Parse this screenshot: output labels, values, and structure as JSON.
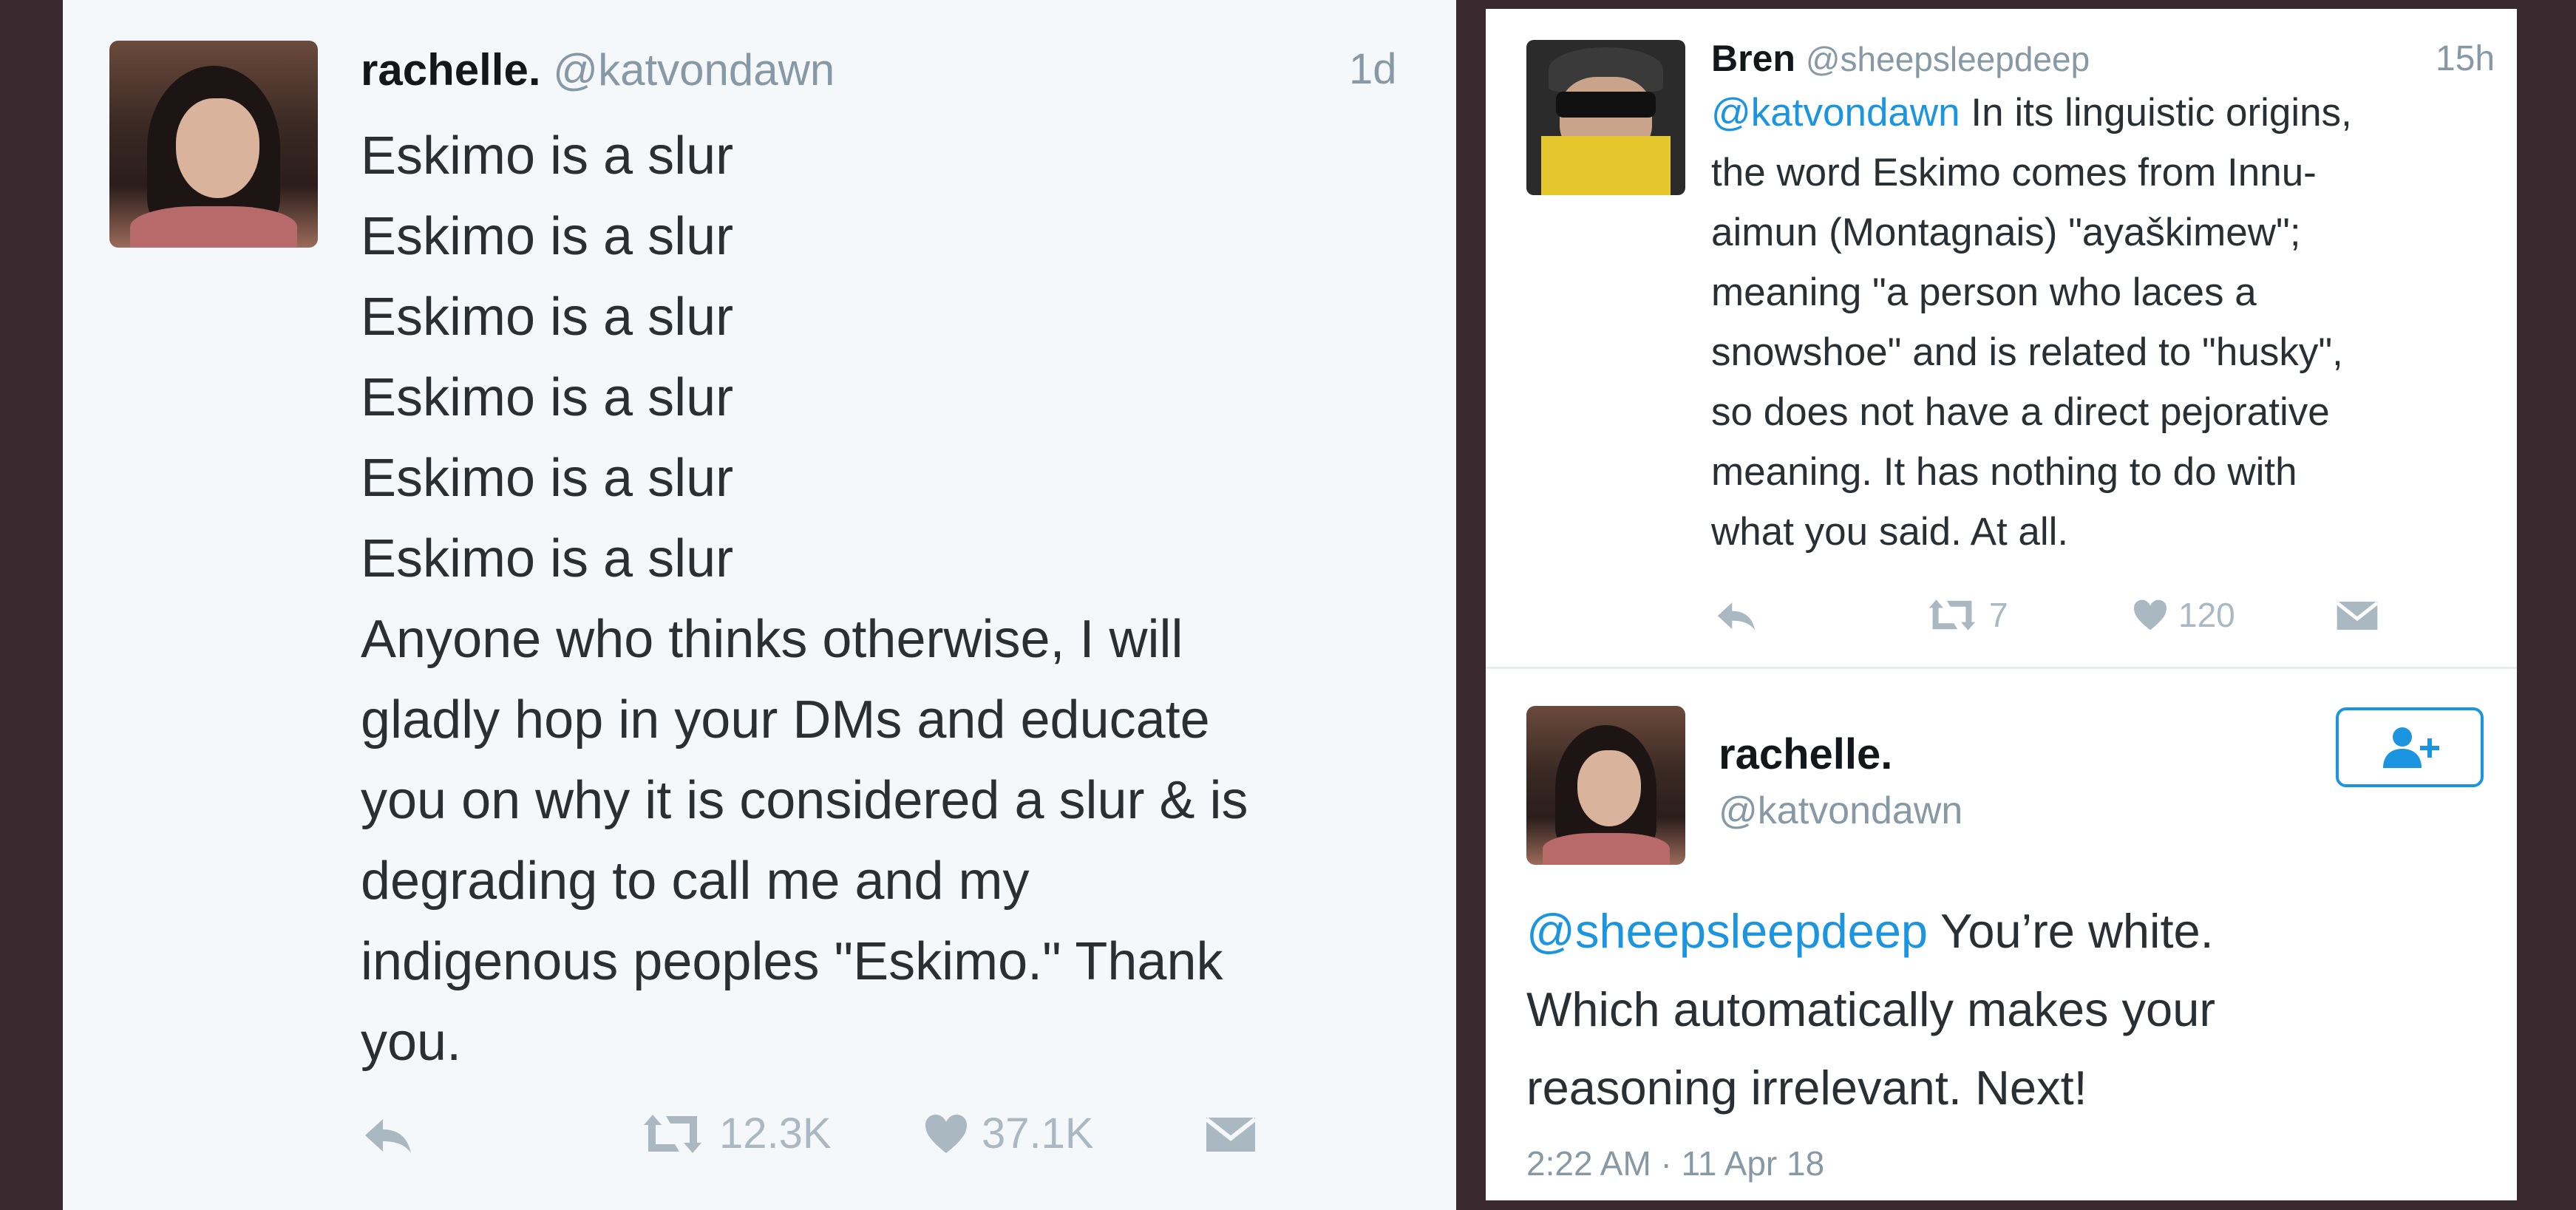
{
  "left_tweet": {
    "name": "rachelle.",
    "handle": "@katvondawn",
    "time": "1d",
    "lines": [
      "Eskimo is a slur",
      "Eskimo is a slur",
      "Eskimo is a slur",
      "Eskimo is a slur",
      "Eskimo is a slur",
      "Eskimo is a slur",
      "Anyone who thinks otherwise, I will",
      "gladly hop in your DMs and educate",
      "you on why it is considered a slur & is",
      "degrading to call me and my",
      "indigenous peoples \"Eskimo.\" Thank",
      "you."
    ],
    "retweets": "12.3K",
    "likes": "37.1K",
    "icons": [
      "reply-icon",
      "retweet-icon",
      "heart-icon",
      "dm-icon"
    ]
  },
  "right_reply": {
    "name": "Bren",
    "handle": "@sheepsleepdeep",
    "time": "15h",
    "mention": "@katvondawn",
    "first_line_rest": " In its linguistic origins,",
    "lines": [
      "the word Eskimo comes from Innu-",
      "aimun (Montagnais) \"ayaškimew\";",
      "meaning \"a person who laces a",
      "snowshoe\" and is related to \"husky\",",
      "so does not have a direct pejorative",
      "meaning. It has nothing to do with",
      "what you said. At all."
    ],
    "retweets": "7",
    "likes": "120"
  },
  "right_tweet": {
    "name": "rachelle.",
    "handle": "@katvondawn",
    "mention": "@sheepsleepdeep",
    "first_line_rest": " You’re white.",
    "lines": [
      "Which automatically makes your",
      "reasoning irrelevant. Next!"
    ],
    "timestamp": "2:22 AM · 11 Apr 18"
  }
}
